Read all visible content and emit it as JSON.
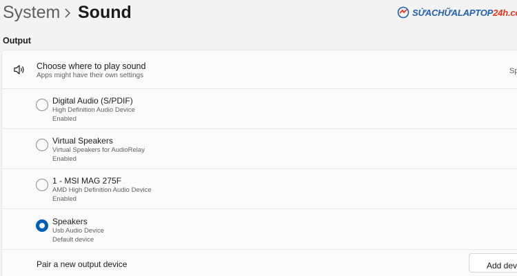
{
  "header": {
    "breadcrumb_parent": "System",
    "breadcrumb_separator_icon": "chevron-right-icon",
    "breadcrumb_current": "Sound"
  },
  "watermark": {
    "text_part1": "SỬACHỮALAPTOP",
    "text_part2": "24h",
    "text_part3": ".com",
    "icon": "logo-mark-icon",
    "colors": {
      "blue": "#1f5fb0",
      "red": "#e8341c"
    }
  },
  "output": {
    "section_title": "Output",
    "choose_title": "Choose where to play sound",
    "choose_subtitle": "Apps might have their own settings",
    "choose_right_text": "Sp",
    "choose_icon": "speaker-icon",
    "devices": [
      {
        "name": "Digital Audio (S/PDIF)",
        "description": "High Definition Audio Device",
        "status": "Enabled",
        "selected": false
      },
      {
        "name": "Virtual Speakers",
        "description": "Virtual Speakers for AudioRelay",
        "status": "Enabled",
        "selected": false
      },
      {
        "name": "1 - MSI MAG 275F",
        "description": "AMD High Definition Audio Device",
        "status": "Enabled",
        "selected": false
      },
      {
        "name": "Speakers",
        "description": "Usb Audio Device",
        "status": "Default device",
        "selected": true
      }
    ],
    "pair_label": "Pair a new output device",
    "add_button_label": "Add device"
  },
  "colors": {
    "accent": "#005fb8",
    "background": "#f3f3f3",
    "card": "#fbfbfb"
  }
}
